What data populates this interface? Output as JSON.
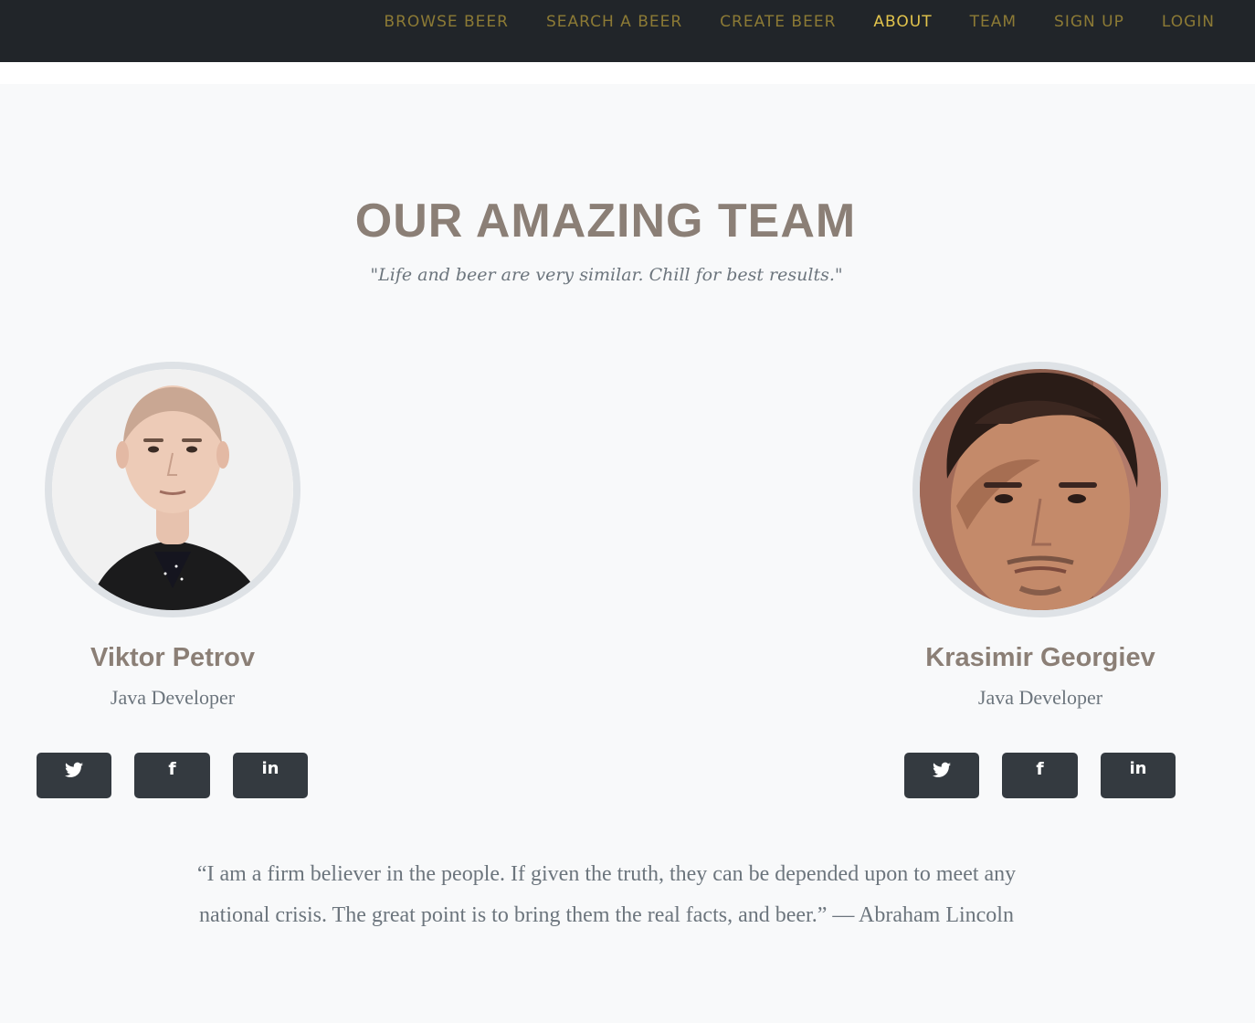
{
  "nav": {
    "items": [
      {
        "label": "BROWSE BEER"
      },
      {
        "label": "SEARCH A BEER"
      },
      {
        "label": "CREATE BEER"
      },
      {
        "label": "ABOUT",
        "active": true
      },
      {
        "label": "TEAM"
      },
      {
        "label": "SIGN UP"
      },
      {
        "label": "LOGIN"
      }
    ]
  },
  "team": {
    "heading": "OUR AMAZING TEAM",
    "subheading": "\"Life and beer are very similar. Chill for best results.\"",
    "members": [
      {
        "name": "Viktor Petrov",
        "role": "Java Developer",
        "social": [
          "twitter-icon",
          "facebook-icon",
          "linkedin-icon"
        ]
      },
      {
        "name": "Krasimir Georgiev",
        "role": "Java Developer",
        "social": [
          "twitter-icon",
          "facebook-icon",
          "linkedin-icon"
        ]
      }
    ]
  },
  "quote": {
    "text": "“I am a firm believer in the people. If given the truth, they can be depended upon to meet any national crisis. The great point is to bring them the real facts, and beer.” — Abraham Lincoln"
  },
  "colors": {
    "navbar_bg": "#212529",
    "nav_link": "#8c7a35",
    "nav_link_active": "#e2c44c",
    "page_bg": "#f8f9fa",
    "heading": "#8b7f76",
    "muted_text": "#6c757d",
    "social_button_bg": "#343a40",
    "avatar_border": "#dee2e6"
  }
}
